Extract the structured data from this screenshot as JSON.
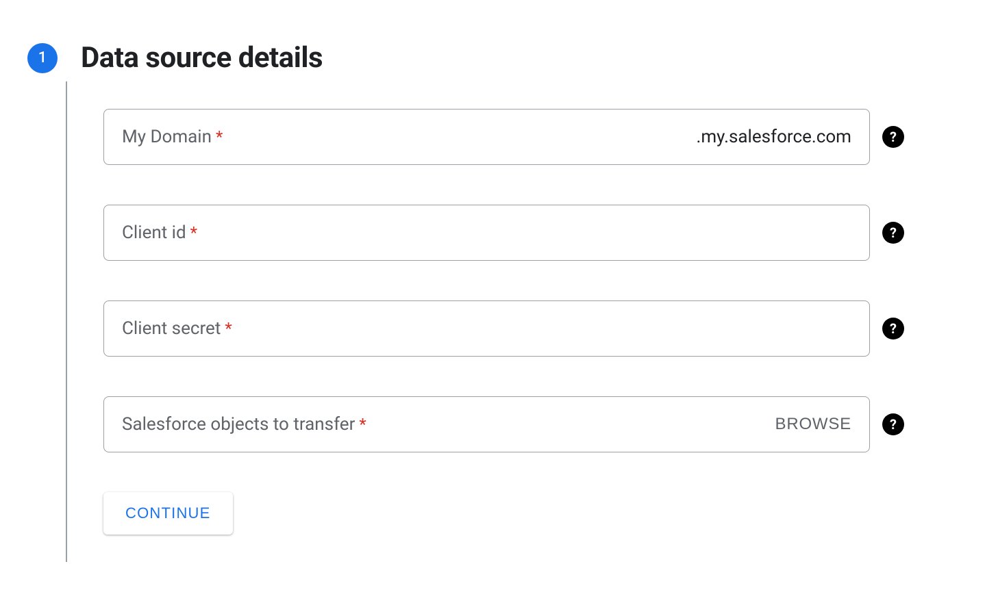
{
  "step": {
    "number": "1",
    "title": "Data source details"
  },
  "fields": {
    "my_domain": {
      "label": "My Domain",
      "suffix": ".my.salesforce.com"
    },
    "client_id": {
      "label": "Client id"
    },
    "client_secret": {
      "label": "Client secret"
    },
    "objects": {
      "label": "Salesforce objects to transfer",
      "action": "BROWSE"
    }
  },
  "required_mark": "*",
  "help_glyph": "?",
  "continue_label": "CONTINUE"
}
